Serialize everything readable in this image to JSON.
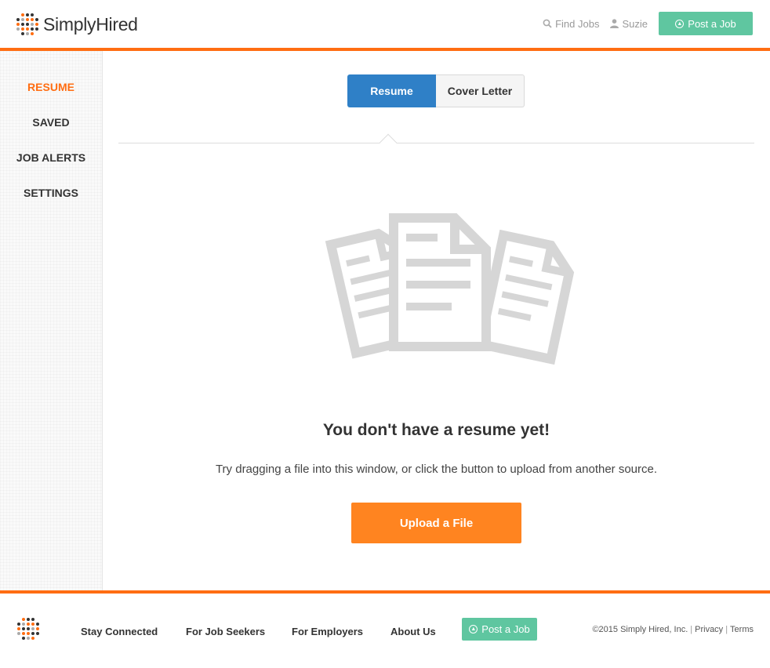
{
  "header": {
    "brand": "SimplyHired",
    "find_jobs": "Find Jobs",
    "user": "Suzie",
    "post_job": "Post a Job"
  },
  "sidebar": {
    "items": [
      {
        "label": "RESUME",
        "active": true
      },
      {
        "label": "SAVED",
        "active": false
      },
      {
        "label": "JOB ALERTS",
        "active": false
      },
      {
        "label": "SETTINGS",
        "active": false
      }
    ]
  },
  "tabs": {
    "resume": "Resume",
    "cover_letter": "Cover Letter",
    "selected": "Resume"
  },
  "empty_state": {
    "title": "You don't have a resume yet!",
    "description": "Try dragging a file into this window, or click the button to upload from another source.",
    "upload_button": "Upload a File",
    "illustration": "documents-icon"
  },
  "footer": {
    "links": [
      "Stay Connected",
      "For Job Seekers",
      "For Employers",
      "About Us"
    ],
    "post_job": "Post a Job",
    "copyright": "©2015 Simply Hired, Inc.",
    "privacy": "Privacy",
    "terms": "Terms"
  },
  "colors": {
    "accent_orange": "#ff6d12",
    "upload_orange": "#ff8420",
    "post_green": "#5fc6a0",
    "tab_blue": "#2f80c7"
  }
}
